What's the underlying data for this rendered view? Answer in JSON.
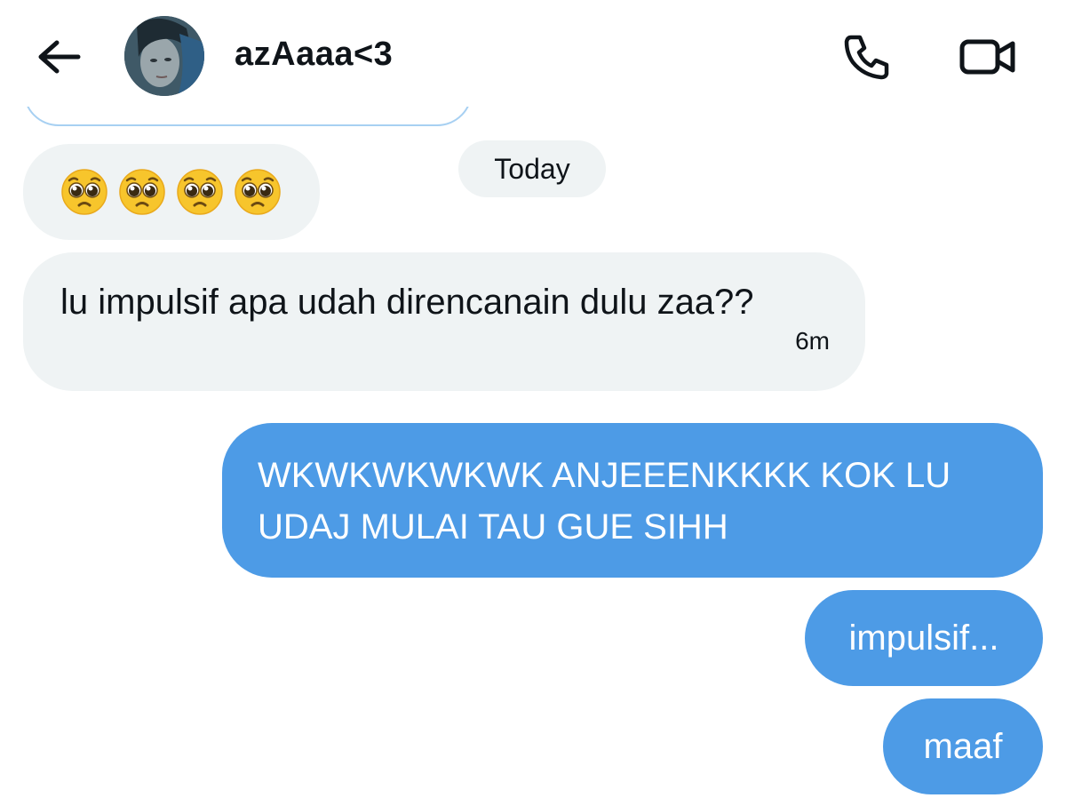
{
  "header": {
    "contact_name": "azAaaa<3",
    "icons": {
      "back": "arrow-left-icon",
      "call": "phone-icon",
      "video": "video-camera-icon"
    }
  },
  "thread": {
    "date_separator": "Today",
    "received": [
      {
        "type": "emoji",
        "emojis": [
          "🥺",
          "🥺",
          "🥺",
          "🥺"
        ]
      },
      {
        "type": "text",
        "text": "lu impulsif apa udah direncanain dulu zaa??",
        "time": "6m"
      }
    ],
    "sent": [
      {
        "line1": "WKWKWKWKWK ANJEEENKKKK KOK LU",
        "line2": "UDAJ MULAI TAU GUE SIHH"
      },
      {
        "text": "impulsif..."
      },
      {
        "text": "maaf"
      }
    ]
  },
  "colors": {
    "sent_bubble": "#4d9be6",
    "received_bubble": "#eff3f4",
    "text_primary": "#0f1419"
  }
}
